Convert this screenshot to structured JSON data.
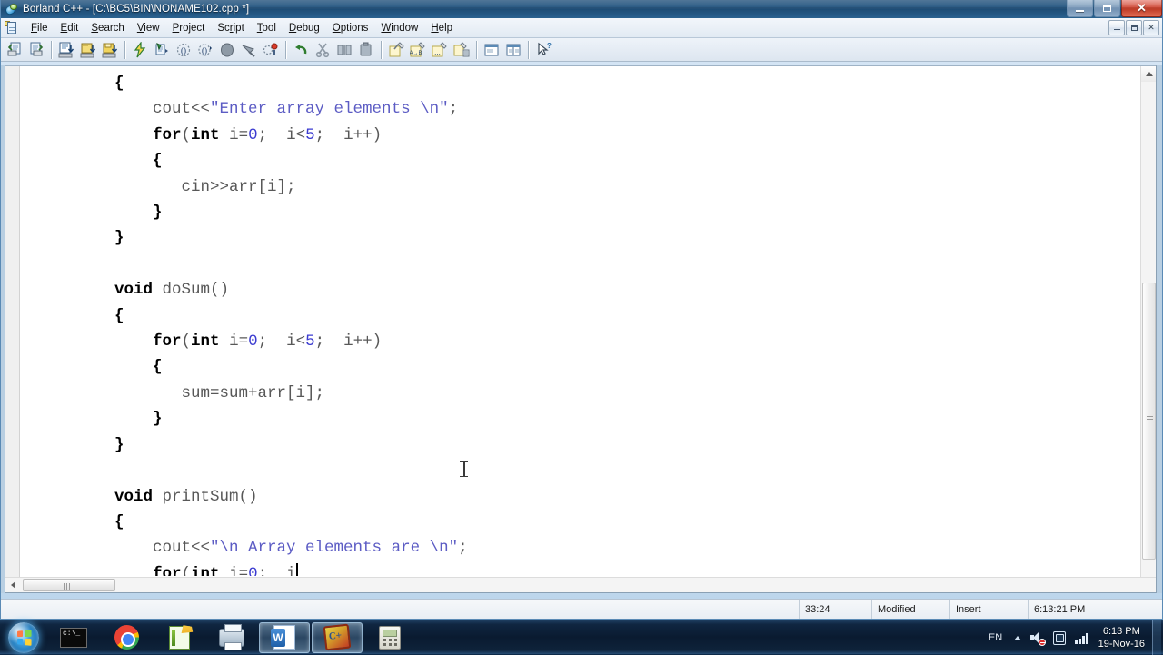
{
  "window": {
    "title": "Borland C++ - [C:\\BC5\\BIN\\NONAME102.cpp *]",
    "app_icon": "borland-globe-icon",
    "controls": {
      "minimize": "minimize-icon",
      "maximize": "maximize-icon",
      "close": "✕"
    }
  },
  "menubar": {
    "doc_icon": "document-icon",
    "items": [
      {
        "label": "File",
        "accel": "F"
      },
      {
        "label": "Edit",
        "accel": "E"
      },
      {
        "label": "Search",
        "accel": "S"
      },
      {
        "label": "View",
        "accel": "V"
      },
      {
        "label": "Project",
        "accel": "P"
      },
      {
        "label": "Script",
        "accel": "r"
      },
      {
        "label": "Tool",
        "accel": "T"
      },
      {
        "label": "Debug",
        "accel": "D"
      },
      {
        "label": "Options",
        "accel": "O"
      },
      {
        "label": "Window",
        "accel": "W"
      },
      {
        "label": "Help",
        "accel": "H"
      }
    ],
    "mdi_controls": {
      "minimize": "mdi-minimize-icon",
      "restore": "mdi-restore-icon",
      "close": "✕"
    }
  },
  "toolbar": {
    "buttons": [
      {
        "name": "open-project-icon",
        "group": 1
      },
      {
        "name": "save-project-icon",
        "group": 1
      },
      {
        "name": "new-file-icon",
        "group": 2
      },
      {
        "name": "open-file-icon",
        "group": 2
      },
      {
        "name": "save-file-icon",
        "group": 2
      },
      {
        "name": "compile-icon",
        "group": 3
      },
      {
        "name": "make-icon",
        "group": 3
      },
      {
        "name": "run-icon",
        "group": 3
      },
      {
        "name": "debug-step-icon",
        "group": 3
      },
      {
        "name": "stop-icon",
        "group": 3
      },
      {
        "name": "trace-icon",
        "group": 3
      },
      {
        "name": "breakpoint-icon",
        "group": 3
      },
      {
        "name": "undo-icon",
        "group": 4
      },
      {
        "name": "cut-icon",
        "group": 4
      },
      {
        "name": "copy-icon",
        "group": 4
      },
      {
        "name": "paste-icon",
        "group": 4
      },
      {
        "name": "search-icon",
        "group": 5
      },
      {
        "name": "replace-icon",
        "group": 5
      },
      {
        "name": "search-again-icon",
        "group": 5
      },
      {
        "name": "search-files-icon",
        "group": 5
      },
      {
        "name": "window-cascade-icon",
        "group": 6
      },
      {
        "name": "window-tile-icon",
        "group": 6
      },
      {
        "name": "context-help-icon",
        "group": 7
      }
    ]
  },
  "editor": {
    "lines": [
      [
        {
          "t": "  ",
          "c": "pln"
        },
        {
          "t": "{",
          "c": "br"
        }
      ],
      [
        {
          "t": "      ",
          "c": "pln"
        },
        {
          "t": "cout<<",
          "c": "pln"
        },
        {
          "t": "\"Enter array elements \\n\"",
          "c": "str"
        },
        {
          "t": ";",
          "c": "pln"
        }
      ],
      [
        {
          "t": "      ",
          "c": "pln"
        },
        {
          "t": "for",
          "c": "kw"
        },
        {
          "t": "(",
          "c": "pln"
        },
        {
          "t": "int",
          "c": "kw"
        },
        {
          "t": " i=",
          "c": "pln"
        },
        {
          "t": "0",
          "c": "num"
        },
        {
          "t": ";  i<",
          "c": "pln"
        },
        {
          "t": "5",
          "c": "num"
        },
        {
          "t": ";  i++)",
          "c": "pln"
        }
      ],
      [
        {
          "t": "      ",
          "c": "pln"
        },
        {
          "t": "{",
          "c": "br"
        }
      ],
      [
        {
          "t": "         ",
          "c": "pln"
        },
        {
          "t": "cin>>arr[i];",
          "c": "pln"
        }
      ],
      [
        {
          "t": "      ",
          "c": "pln"
        },
        {
          "t": "}",
          "c": "br"
        }
      ],
      [
        {
          "t": "  ",
          "c": "pln"
        },
        {
          "t": "}",
          "c": "br"
        }
      ],
      [
        {
          "t": "",
          "c": "pln"
        }
      ],
      [
        {
          "t": "  ",
          "c": "pln"
        },
        {
          "t": "void",
          "c": "kw"
        },
        {
          "t": " doSum()",
          "c": "pln"
        }
      ],
      [
        {
          "t": "  ",
          "c": "pln"
        },
        {
          "t": "{",
          "c": "br"
        }
      ],
      [
        {
          "t": "      ",
          "c": "pln"
        },
        {
          "t": "for",
          "c": "kw"
        },
        {
          "t": "(",
          "c": "pln"
        },
        {
          "t": "int",
          "c": "kw"
        },
        {
          "t": " i=",
          "c": "pln"
        },
        {
          "t": "0",
          "c": "num"
        },
        {
          "t": ";  i<",
          "c": "pln"
        },
        {
          "t": "5",
          "c": "num"
        },
        {
          "t": ";  i++)",
          "c": "pln"
        }
      ],
      [
        {
          "t": "      ",
          "c": "pln"
        },
        {
          "t": "{",
          "c": "br"
        }
      ],
      [
        {
          "t": "         ",
          "c": "pln"
        },
        {
          "t": "sum=sum+arr[i];",
          "c": "pln"
        }
      ],
      [
        {
          "t": "      ",
          "c": "pln"
        },
        {
          "t": "}",
          "c": "br"
        }
      ],
      [
        {
          "t": "  ",
          "c": "pln"
        },
        {
          "t": "}",
          "c": "br"
        }
      ],
      [
        {
          "t": "",
          "c": "pln"
        }
      ],
      [
        {
          "t": "  ",
          "c": "pln"
        },
        {
          "t": "void",
          "c": "kw"
        },
        {
          "t": " printSum()",
          "c": "pln"
        }
      ],
      [
        {
          "t": "  ",
          "c": "pln"
        },
        {
          "t": "{",
          "c": "br"
        }
      ],
      [
        {
          "t": "      ",
          "c": "pln"
        },
        {
          "t": "cout<<",
          "c": "pln"
        },
        {
          "t": "\"\\n Array elements are \\n\"",
          "c": "str"
        },
        {
          "t": ";",
          "c": "pln"
        }
      ],
      [
        {
          "t": "      ",
          "c": "pln"
        },
        {
          "t": "for",
          "c": "kw"
        },
        {
          "t": "(",
          "c": "pln"
        },
        {
          "t": "int",
          "c": "kw"
        },
        {
          "t": " i=",
          "c": "pln"
        },
        {
          "t": "0",
          "c": "num"
        },
        {
          "t": ";  i",
          "c": "pln"
        },
        {
          "t": "|caret|",
          "c": "caret"
        }
      ]
    ],
    "mouse_cursor": "text-ibeam-cursor"
  },
  "statusbar": {
    "position": "33:24",
    "modified": "Modified",
    "insert_mode": "Insert",
    "time": "6:13:21 PM"
  },
  "taskbar": {
    "start": "windows-start-orb-icon",
    "tasks": [
      {
        "name": "command-prompt-icon",
        "icon": "cmd",
        "active": false
      },
      {
        "name": "google-chrome-icon",
        "icon": "chrome",
        "active": false
      },
      {
        "name": "notepadpp-icon",
        "icon": "npp",
        "active": false
      },
      {
        "name": "printer-icon",
        "icon": "printer",
        "active": false
      },
      {
        "name": "microsoft-word-icon",
        "icon": "word",
        "active": true
      },
      {
        "name": "borland-cpp-icon",
        "icon": "borland",
        "active": true
      },
      {
        "name": "calculator-icon",
        "icon": "calc",
        "active": false
      }
    ],
    "tray": {
      "language": "EN",
      "icons": [
        "show-hidden-icons-chevron",
        "volume-muted-icon",
        "action-center-icon",
        "network-signal-icon"
      ],
      "clock_time": "6:13 PM",
      "clock_date": "19-Nov-16"
    }
  },
  "colors": {
    "keyword": "#000000",
    "string": "#5c5cc4",
    "number": "#3b3bd0",
    "plain": "#585858",
    "titlebar": "#1f4f7a",
    "close_button": "#cf4a38"
  }
}
